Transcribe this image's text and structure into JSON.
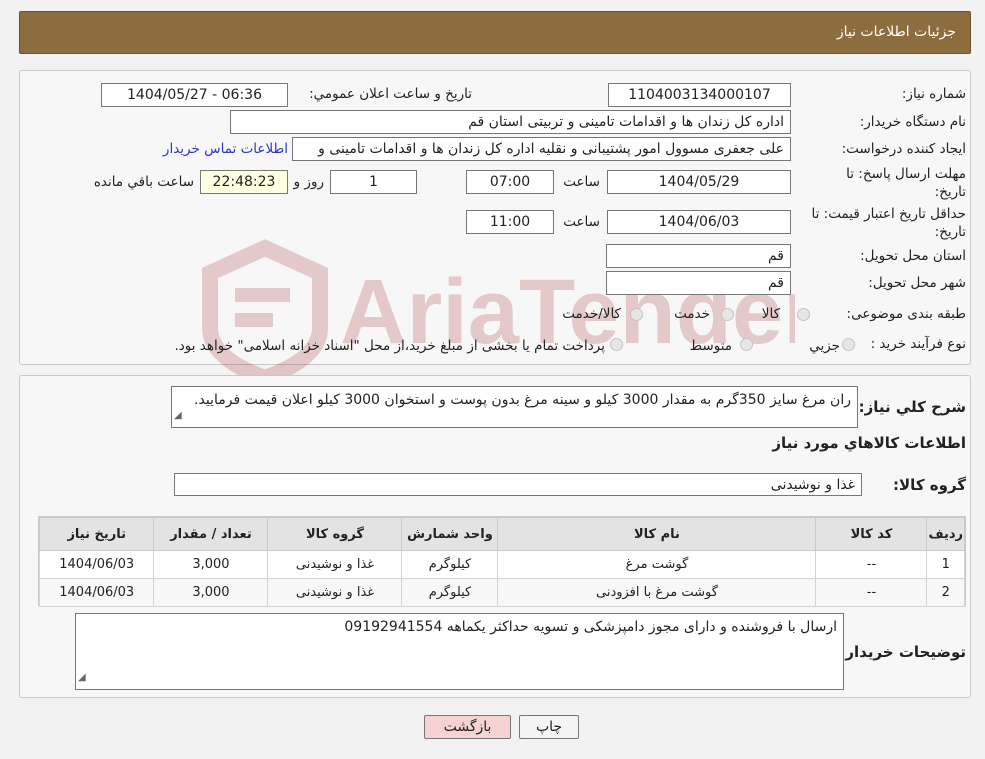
{
  "page_title": "جزئیات اطلاعات نیاز",
  "fields": {
    "need_number_label": "شماره نیاز:",
    "need_number": "1104003134000107",
    "announce_label": "تاریخ و ساعت اعلان عمومي:",
    "announce_value": "1404/05/27 - 06:36",
    "buyer_org_label": "نام دستگاه خريدار:",
    "buyer_org": "اداره کل زندان ها و اقدامات تامینی و تربیتی استان قم",
    "creator_label": "ايجاد کننده درخواست:",
    "creator": "علی جعفری مسوول امور پشتیبانی و نقلیه اداره کل زندان ها و اقدامات تامینی و",
    "contact_link": "اطلاعات تماس خريدار",
    "reply_deadline_label_1": "مهلت ارسال پاسخ: تا",
    "reply_deadline_label_2": "تاريخ:",
    "reply_date": "1404/05/29",
    "time_label": "ساعت",
    "reply_time": "07:00",
    "days_value": "1",
    "days_label": "روز و",
    "remaining_time": "22:48:23",
    "remaining_label": "ساعت باقي مانده",
    "validity_label_1": "حداقل تاريخ اعتبار قيمت: تا",
    "validity_label_2": "تاريخ:",
    "validity_date": "1404/06/03",
    "validity_time": "11:00",
    "province_label": "استان محل تحويل:",
    "province": "قم",
    "city_label": "شهر محل تحويل:",
    "city": "قم",
    "category_label": "طبقه بندی موضوعی:",
    "category_options": [
      "کالا",
      "خدمت",
      "کالا/خدمت"
    ],
    "process_label": "نوع فرآيند خريد :",
    "process_options": [
      "جزيي",
      "متوسط"
    ],
    "payment_note": "پرداخت تمام يا بخشی از مبلغ خريد،از محل \"اسناد خزانه اسلامی\" خواهد بود."
  },
  "description": {
    "label": "شرح کلي نياز:",
    "text": "ران مرغ سایز 350گرم به مقدار 3000 کیلو و سینه مرغ بدون پوست و استخوان 3000 کیلو اعلان قیمت فرمایید."
  },
  "goods": {
    "section_title": "اطلاعات کالاهاي مورد نياز",
    "group_label": "گروه کالا:",
    "group_value": "غذا و نوشیدنی",
    "columns": [
      "رديف",
      "کد کالا",
      "نام کالا",
      "واحد شمارش",
      "گروه کالا",
      "تعداد / مقدار",
      "تاريخ نياز"
    ],
    "rows": [
      [
        "1",
        "--",
        "گوشت مرغ",
        "کيلوگرم",
        "غذا و نوشیدنی",
        "3,000",
        "1404/06/03"
      ],
      [
        "2",
        "--",
        "گوشت مرغ با افزودنی",
        "کيلوگرم",
        "غذا و نوشیدنی",
        "3,000",
        "1404/06/03"
      ]
    ]
  },
  "buyer_notes": {
    "label": "توضيحات خريدار:",
    "text": "ارسال با فروشنده و دارای مجوز دامپزشکی و تسویه حداکثر یکماهه 09192941554"
  },
  "buttons": {
    "print": "چاپ",
    "back": "بازگشت"
  },
  "watermark_text": "AriaTender.neT",
  "colors": {
    "header_bg": "#8c6d40",
    "link": "#2a37c8",
    "back_button_bg": "#f6d2d2",
    "timer_bg": "#fefee0"
  }
}
